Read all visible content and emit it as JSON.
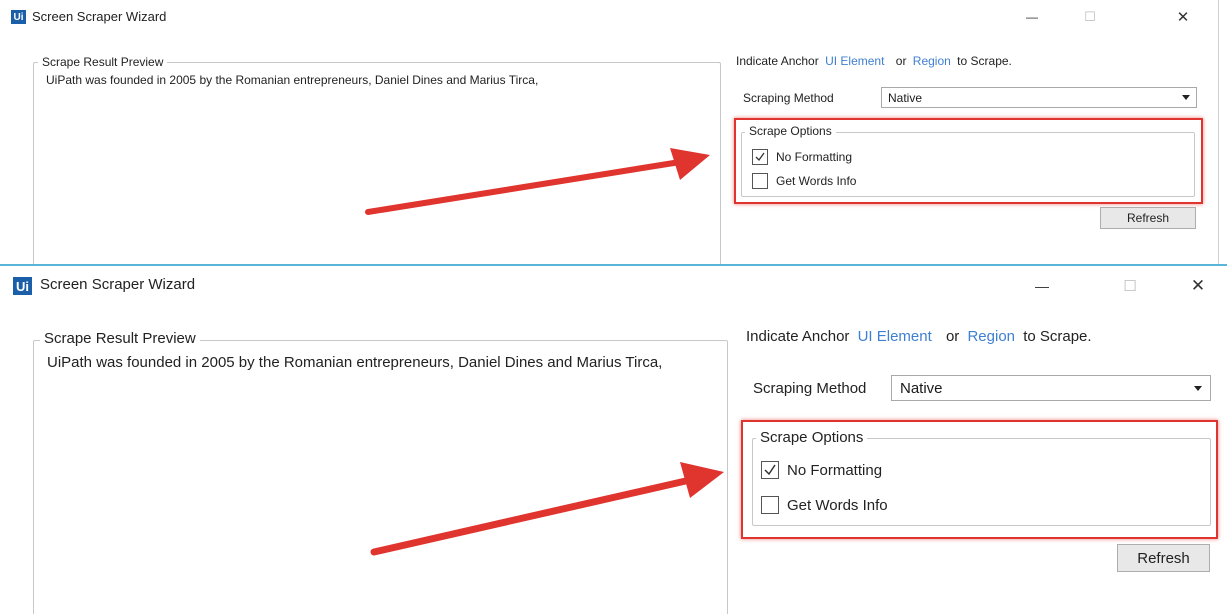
{
  "window": {
    "logo_text": "Ui",
    "title": "Screen Scraper Wizard",
    "minimize_glyph": "—",
    "maximize_glyph": "☐",
    "close_glyph": "✕"
  },
  "preview": {
    "legend": "Scrape Result Preview",
    "text": "UiPath was founded in 2005 by the Romanian entrepreneurs, Daniel Dines and Marius Tirca,"
  },
  "anchor": {
    "prefix": "Indicate Anchor",
    "ui_element_link": "UI Element",
    "or": "or",
    "region_link": "Region",
    "suffix": "to Scrape."
  },
  "scraping_method": {
    "label": "Scraping Method",
    "value": "Native"
  },
  "scrape_options": {
    "legend": "Scrape Options",
    "no_formatting": {
      "label": "No Formatting",
      "checked": true
    },
    "get_words_info": {
      "label": "Get Words Info",
      "checked": false
    }
  },
  "refresh_label": "Refresh",
  "colors": {
    "highlight_red": "#e0342f",
    "link_blue": "#3f7fd1",
    "logo_blue": "#1a5fa8"
  },
  "icons": {
    "annotation": "red-arrow-icon",
    "check": "checkmark-icon"
  }
}
